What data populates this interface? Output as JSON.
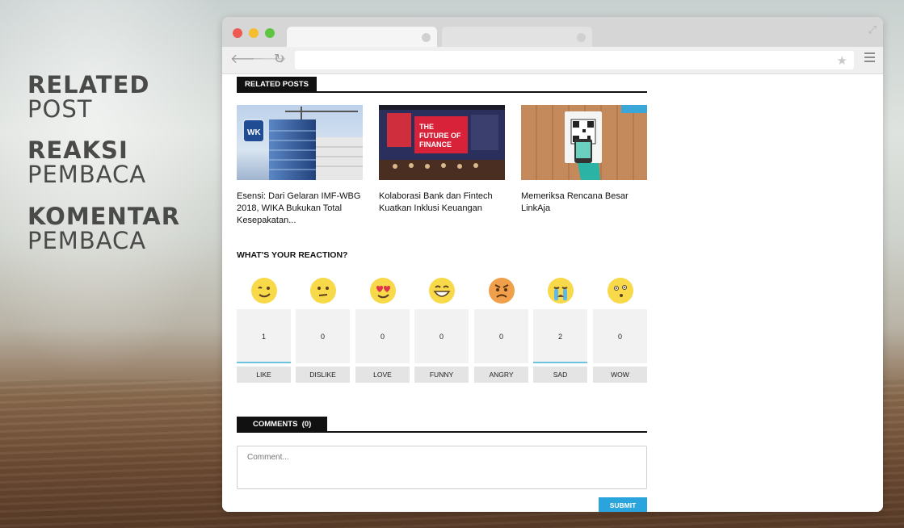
{
  "captions": [
    {
      "bold": "RELATED",
      "light": "POST"
    },
    {
      "bold": "REAKSI",
      "light": "PEMBACA"
    },
    {
      "bold": "KOMENTAR",
      "light": "PEMBACA"
    }
  ],
  "browser": {
    "url": "",
    "icons": {
      "back": "arrow-left-icon",
      "forward": "arrow-right-icon",
      "reload": "reload-icon",
      "bookmark": "star-icon",
      "menu": "hamburger-menu-icon",
      "expand": "expand-icon"
    }
  },
  "related": {
    "heading": "RELATED POSTS",
    "posts": [
      {
        "title": "Esensi: Dari Gelaran IMF-WBG 2018, WIKA Bukukan Total Kesepakatan..."
      },
      {
        "title": "Kolaborasi Bank dan Fintech Kuatkan Inklusi Keuangan"
      },
      {
        "title": "Memeriksa Rencana Besar LinkAja"
      }
    ]
  },
  "reactions": {
    "heading": "WHAT'S YOUR REACTION?",
    "items": [
      {
        "label": "LIKE",
        "count": "1",
        "active": true,
        "emoji": "wink-emoji-icon"
      },
      {
        "label": "DISLIKE",
        "count": "0",
        "active": false,
        "emoji": "neutral-emoji-icon"
      },
      {
        "label": "LOVE",
        "count": "0",
        "active": false,
        "emoji": "heart-eyes-emoji-icon"
      },
      {
        "label": "FUNNY",
        "count": "0",
        "active": false,
        "emoji": "laughing-emoji-icon"
      },
      {
        "label": "ANGRY",
        "count": "0",
        "active": false,
        "emoji": "angry-emoji-icon"
      },
      {
        "label": "SAD",
        "count": "2",
        "active": true,
        "emoji": "crying-emoji-icon"
      },
      {
        "label": "WOW",
        "count": "0",
        "active": false,
        "emoji": "surprised-emoji-icon"
      }
    ]
  },
  "comments": {
    "heading": "COMMENTS",
    "count": "(0)",
    "placeholder": "Comment...",
    "submit_label": "SUBMIT"
  },
  "colors": {
    "accent": "#2aa4dc",
    "bar": "#6cc3e1",
    "heading_bg": "#111111"
  }
}
